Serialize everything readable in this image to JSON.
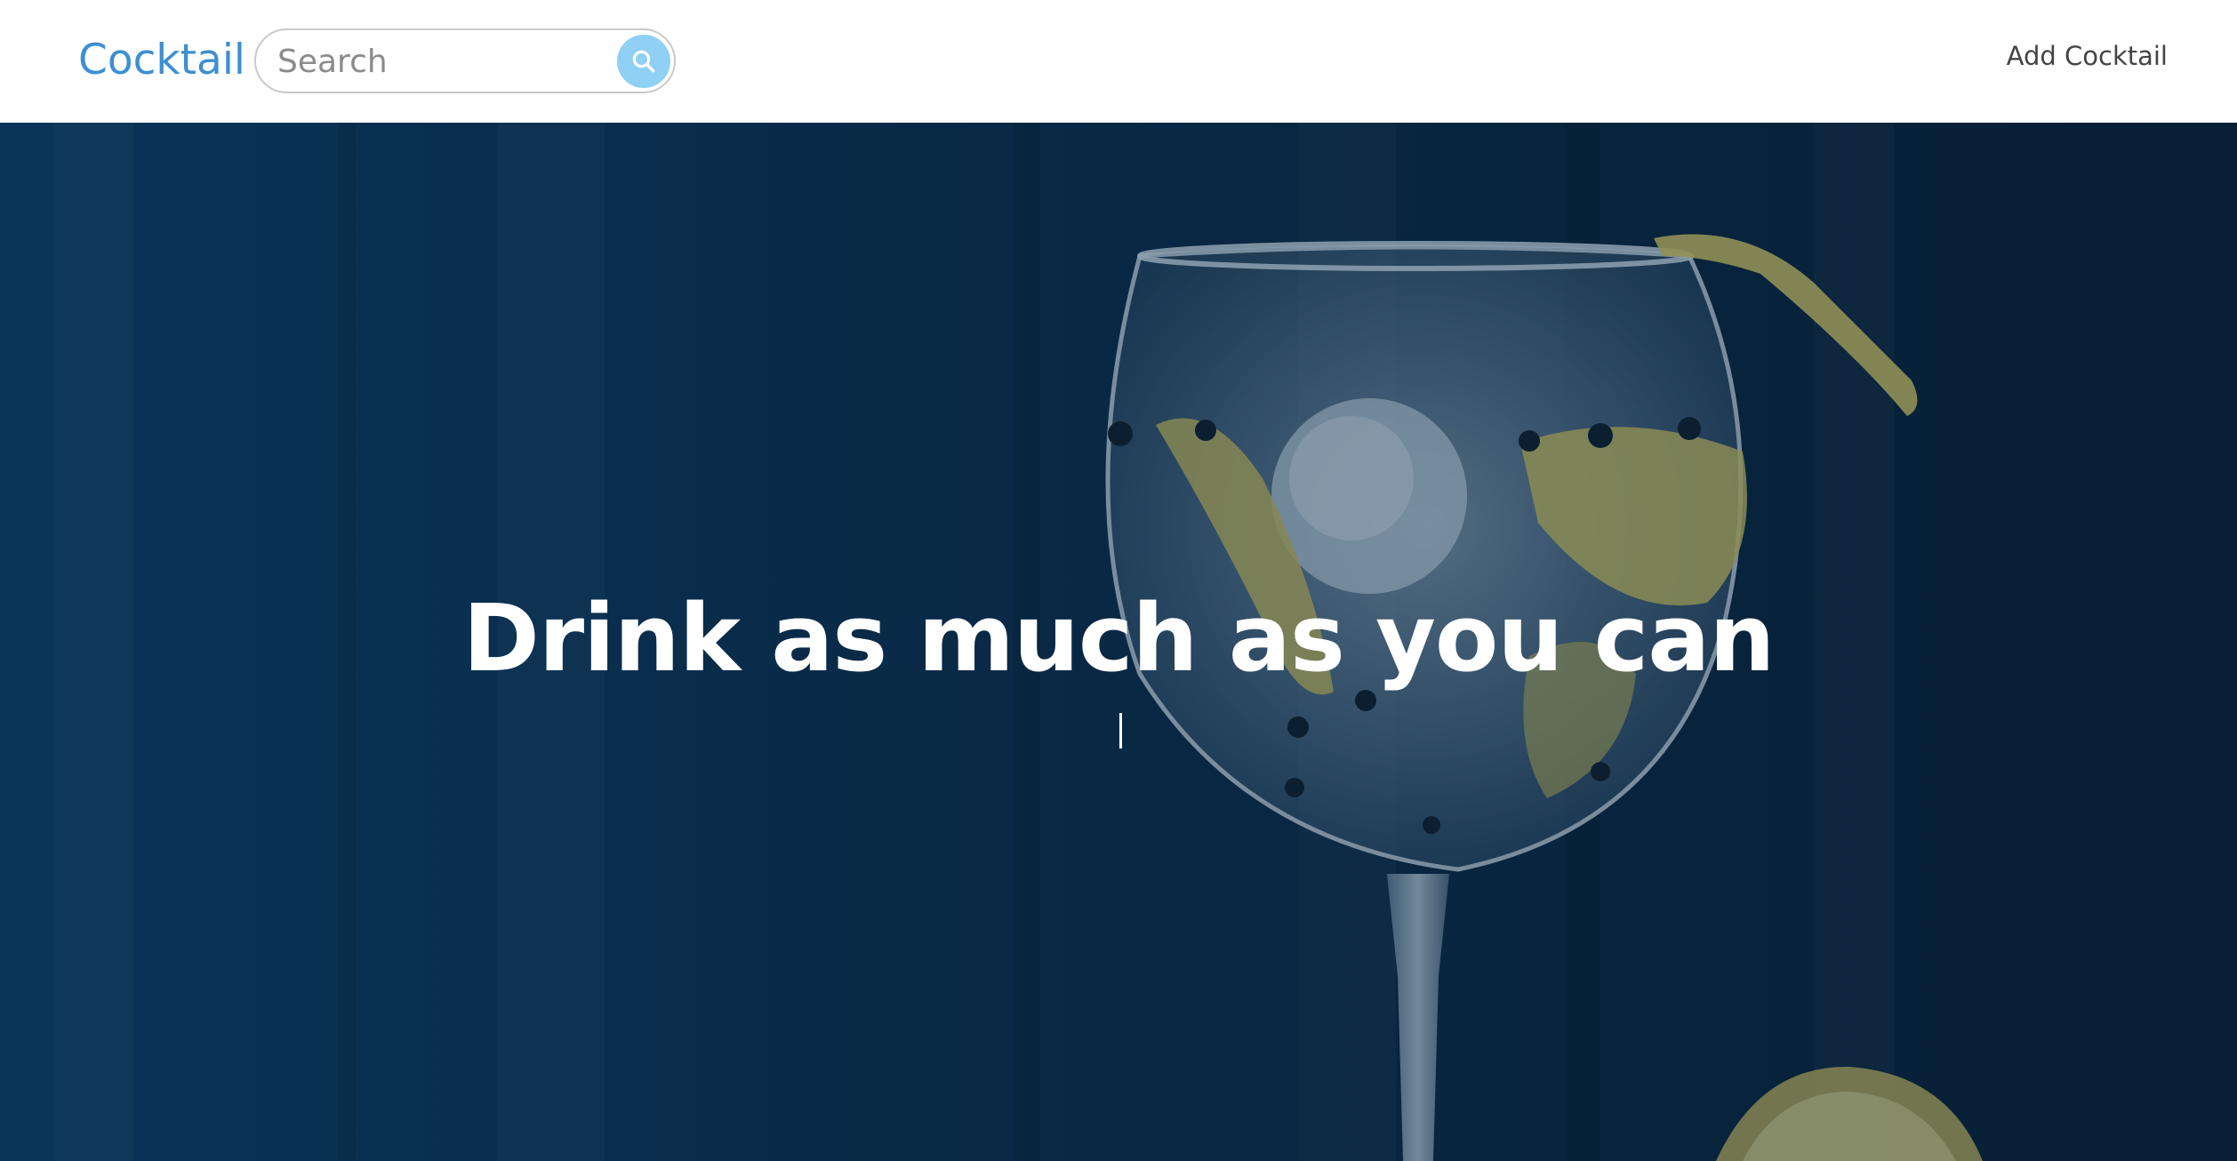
{
  "navbar": {
    "brand": "Cocktail",
    "search": {
      "placeholder": "Search",
      "value": ""
    },
    "add_link": "Add Cocktail",
    "colors": {
      "brand": "#3d8fd1",
      "search_button": "#8fd0f4"
    }
  },
  "hero": {
    "title": "Drink as much as you can",
    "subtitle_cursor": "|",
    "image": "cocktail-glass-with-ice-and-lemon",
    "overlay_color": "#0a2a48"
  },
  "icons": {
    "search_button": "search-icon"
  }
}
